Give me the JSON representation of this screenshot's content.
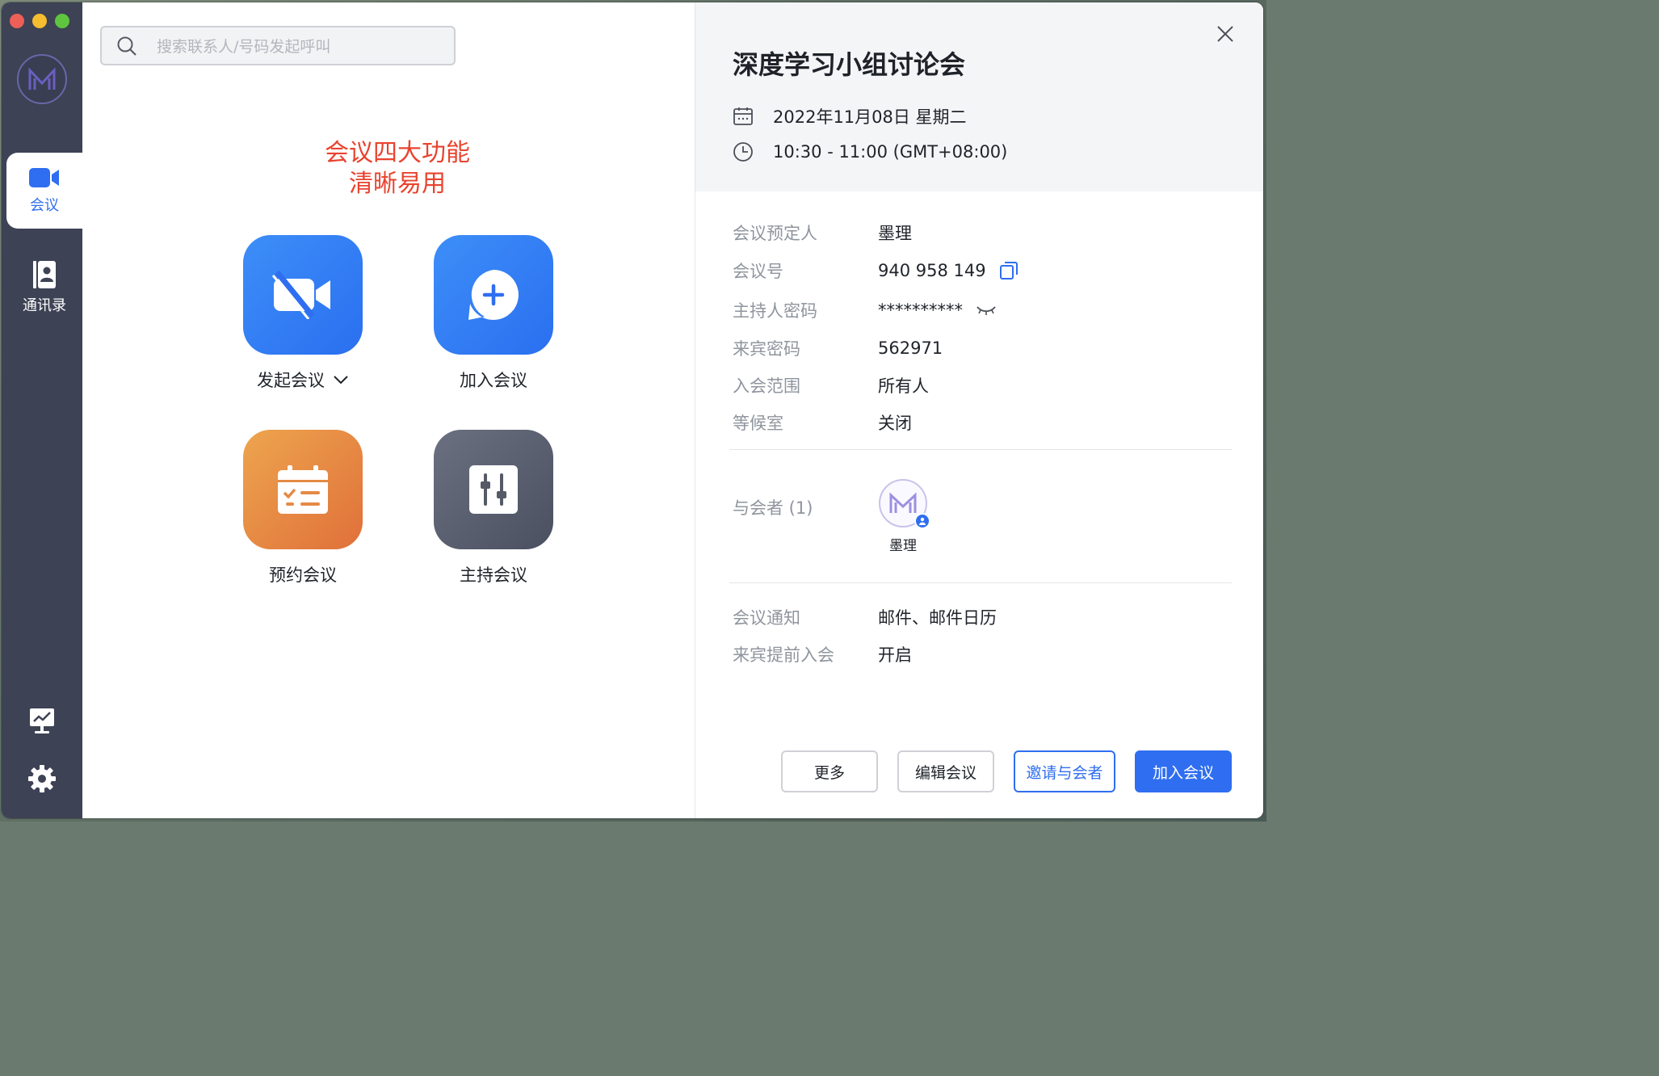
{
  "sidebar": {
    "nav": [
      {
        "label": "会议",
        "icon": "video-camera-icon",
        "active": true
      },
      {
        "label": "通讯录",
        "icon": "contacts-book-icon",
        "active": false
      }
    ],
    "bottom_icons": [
      "screen-share-icon",
      "gear-icon"
    ]
  },
  "search": {
    "placeholder": "搜索联系人/号码发起呼叫"
  },
  "promo": {
    "line1": "会议四大功能",
    "line2": "清晰易用"
  },
  "actions": {
    "start": {
      "label": "发起会议"
    },
    "join": {
      "label": "加入会议"
    },
    "schedule": {
      "label": "预约会议"
    },
    "host": {
      "label": "主持会议"
    }
  },
  "detail": {
    "title": "深度学习小组讨论会",
    "date": "2022年11月08日 星期二",
    "time": "10:30 - 11:00 (GMT+08:00)",
    "rows": {
      "organizer": {
        "key": "会议预定人",
        "value": "墨理"
      },
      "meeting_id": {
        "key": "会议号",
        "value": "940 958 149"
      },
      "host_password": {
        "key": "主持人密码",
        "value": "**********"
      },
      "guest_password": {
        "key": "来宾密码",
        "value": "562971"
      },
      "join_scope": {
        "key": "入会范围",
        "value": "所有人"
      },
      "waiting_room": {
        "key": "等候室",
        "value": "关闭"
      },
      "notification": {
        "key": "会议通知",
        "value": "邮件、邮件日历"
      },
      "early_join": {
        "key": "来宾提前入会",
        "value": "开启"
      }
    },
    "participants_label": "与会者 (1)",
    "participants": [
      {
        "name": "墨理"
      }
    ],
    "buttons": {
      "more": "更多",
      "edit": "编辑会议",
      "invite": "邀请与会者",
      "join": "加入会议"
    }
  },
  "colors": {
    "accent": "#2f6ef0",
    "sidebar": "#3d4254",
    "promo": "#e8432e"
  }
}
